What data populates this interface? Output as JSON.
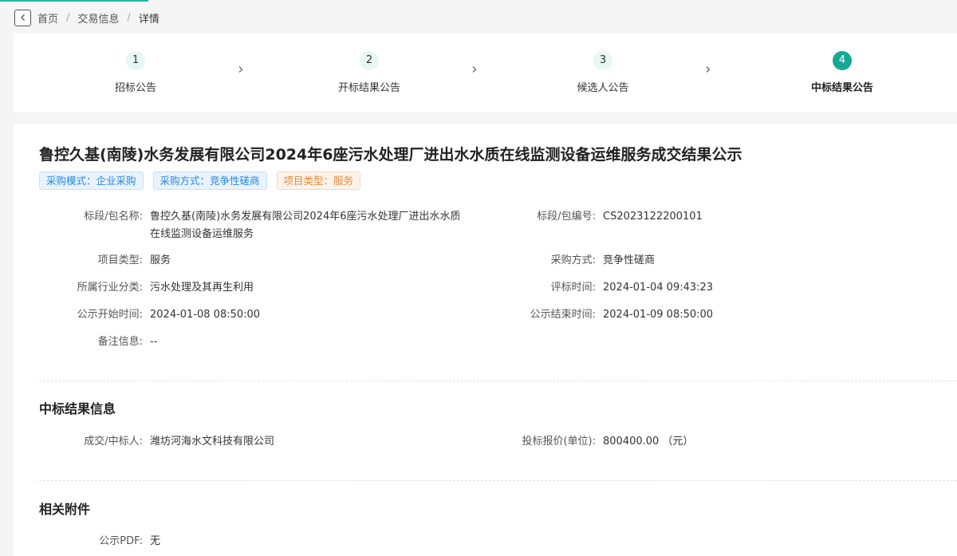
{
  "breadcrumb": {
    "home": "首页",
    "trade": "交易信息",
    "current": "详情",
    "separator": "/"
  },
  "steps": [
    {
      "num": "1",
      "label": "招标公告"
    },
    {
      "num": "2",
      "label": "开标结果公告"
    },
    {
      "num": "3",
      "label": "候选人公告"
    },
    {
      "num": "4",
      "label": "中标结果公告"
    }
  ],
  "active_step": 4,
  "title": "鲁控久基(南陵)水务发展有限公司2024年6座污水处理厂进出水水质在线监测设备运维服务成交结果公示",
  "tags": [
    {
      "text": "采购模式：企业采购",
      "color": "blue"
    },
    {
      "text": "采购方式：竞争性磋商",
      "color": "blue"
    },
    {
      "text": "项目类型：服务",
      "color": "orange"
    }
  ],
  "info": {
    "package_name_label": "标段/包名称:",
    "package_name_line1": "鲁控久基(南陵)水务发展有限公司2024年6座污水处理厂进出水水质",
    "package_name_line2": "在线监测设备运维服务",
    "package_no_label": "标段/包编号:",
    "package_no": "CS2023122200101",
    "project_type_label": "项目类型:",
    "project_type": "服务",
    "purchase_method_label": "采购方式:",
    "purchase_method": "竞争性磋商",
    "industry_label": "所属行业分类:",
    "industry": "污水处理及其再生利用",
    "eval_time_label": "评标时间:",
    "eval_time": "2024-01-04 09:43:23",
    "pub_start_label": "公示开始时间:",
    "pub_start": "2024-01-08 08:50:00",
    "pub_end_label": "公示结束时间:",
    "pub_end": "2024-01-09 08:50:00",
    "remark_label": "备注信息:",
    "remark": "--"
  },
  "result": {
    "section_title": "中标结果信息",
    "winner_label": "成交/中标人:",
    "winner": "潍坊河海水文科技有限公司",
    "price_label": "投标报价(单位):",
    "price": "800400.00 （元）"
  },
  "attachments": {
    "section_title": "相关附件",
    "pdf_label": "公示PDF:",
    "pdf": "无"
  },
  "colors": {
    "accent": "#17a795",
    "step_bg": "#e6f7f4",
    "tag_blue": "#2b87d8",
    "tag_orange": "#e08a3c"
  }
}
